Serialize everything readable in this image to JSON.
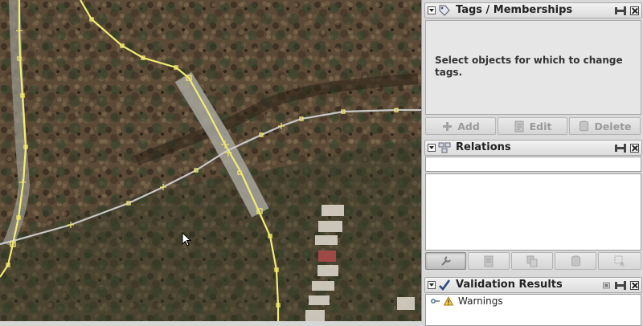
{
  "panels": {
    "tags": {
      "title": "Tags / Memberships",
      "message": "Select objects for which to change tags.",
      "buttons": {
        "add": "Add",
        "edit": "Edit",
        "delete": "Delete"
      }
    },
    "relations": {
      "title": "Relations",
      "filter_value": ""
    },
    "validation": {
      "title": "Validation Results",
      "warnings_label": "Warnings"
    }
  },
  "colors": {
    "way_highlight": "#f2ec74",
    "way_gray": "#c8c8c8",
    "node_marker": "#eee36a",
    "panel_bg": "#d9d9d9"
  }
}
